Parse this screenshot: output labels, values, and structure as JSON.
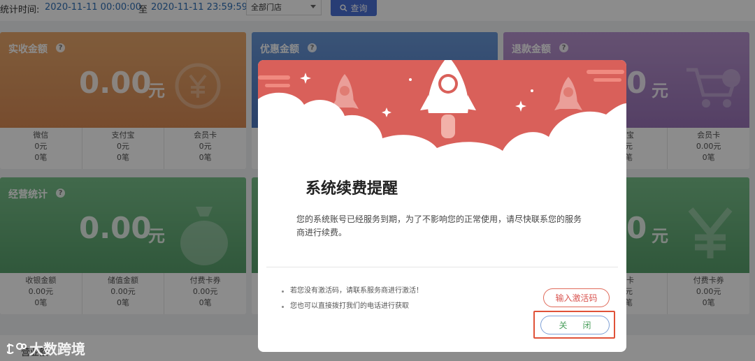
{
  "filter": {
    "label": "统计时间:",
    "date_from": "2020-11-11 00:00:00",
    "separator": "至",
    "date_to": "2020-11-11 23:59:59",
    "store_value": "全部门店",
    "search_label": "查询"
  },
  "cards": [
    {
      "title": "实收金额",
      "amount": "0.00",
      "unit": "元",
      "color": "#df9a60",
      "cells": [
        {
          "label": "微信",
          "amount": "0元",
          "count": "0笔"
        },
        {
          "label": "支付宝",
          "amount": "0元",
          "count": "0笔"
        },
        {
          "label": "会员卡",
          "amount": "0元",
          "count": "0笔"
        }
      ]
    },
    {
      "title": "优惠金额",
      "color": "#5b86cb"
    },
    {
      "title": "退款金额",
      "amount": "0",
      "unit": "元",
      "color": "#a984c3",
      "cells": [
        {
          "label": "付宝",
          "amount": "0元",
          "count": "0笔"
        },
        {
          "label": "会员卡",
          "amount": "0.00元",
          "count": "0笔"
        }
      ]
    },
    {
      "title": "经营统计",
      "amount": "0.00",
      "unit": "元",
      "color": "#68b07c",
      "cells": [
        {
          "label": "收银金额",
          "amount": "0.00元",
          "count": "0笔"
        },
        {
          "label": "储值金额",
          "amount": "0.00元",
          "count": "0笔"
        },
        {
          "label": "付费卡券",
          "amount": "0.00元",
          "count": "0笔"
        }
      ]
    },
    {
      "title": "",
      "amount": "0",
      "unit": "元",
      "color": "#68b07c",
      "cells": [
        {
          "label": "开卡",
          "amount": "0元",
          "count": "0笔"
        },
        {
          "label": "付费卡券",
          "amount": "0.00元",
          "count": "0笔"
        }
      ]
    }
  ],
  "bottom_label": "营业额",
  "watermark": "大数跨境",
  "modal": {
    "title": "系统续费提醒",
    "description": "您的系统账号已经服务到期，为了不影响您的正常使用，请尽快联系您的服务商进行续费。",
    "tips": [
      "若您没有激活码，请联系服务商进行激活！",
      "您也可以直接拨打我们的电话进行获取"
    ],
    "activate_label": "输入激活码",
    "close_label": "关闭",
    "banner_color": "#d9605a"
  }
}
